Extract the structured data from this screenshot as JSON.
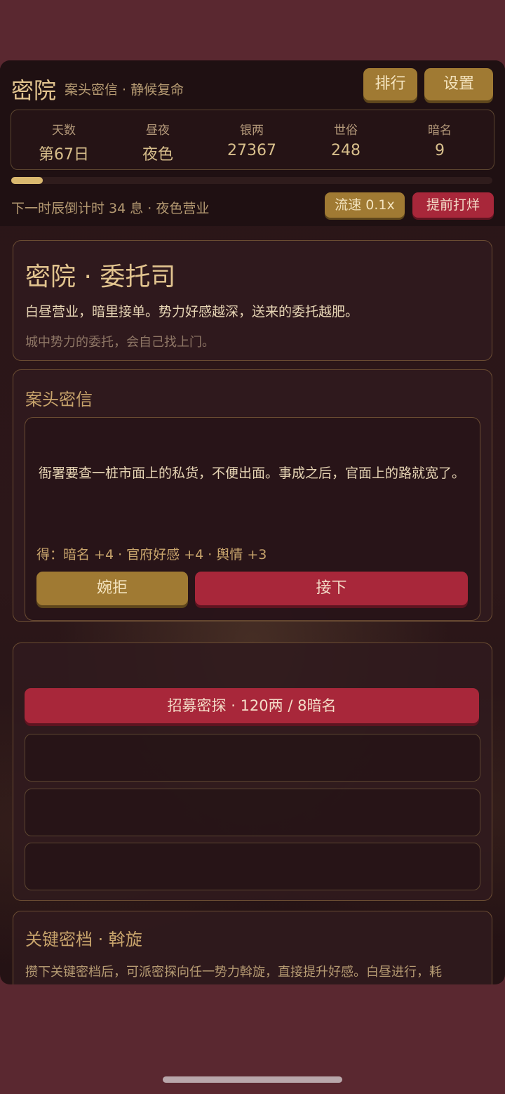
{
  "header": {
    "title": "密院",
    "subtitle": "案头密信 · 静候复命",
    "rank_label": "排行",
    "settings_label": "设置"
  },
  "stats": [
    {
      "label": "天数",
      "value": "第67日"
    },
    {
      "label": "昼夜",
      "value": "夜色"
    },
    {
      "label": "银两",
      "value": "27367"
    },
    {
      "label": "世俗",
      "value": "248"
    },
    {
      "label": "暗名",
      "value": "9"
    }
  ],
  "progress": {
    "fraction": 0.065
  },
  "timer": {
    "countdown_text": "下一时辰倒计时 34 息 · 夜色营业",
    "speed_label": "流速 0.1x",
    "close_early_label": "提前打烊"
  },
  "intro": {
    "title": "密院 · 委托司",
    "desc": "白昼营业，暗里接单。势力好感越深，送来的委托越肥。",
    "hint": "城中势力的委托，会自己找上门。"
  },
  "letters": {
    "title": "案头密信",
    "letter": {
      "body": "衙署要查一桩市面上的私货，不便出面。事成之后，官面上的路就宽了。",
      "reward": "得：暗名 +4 · 官府好感 +4 · 舆情 +3",
      "decline_label": "婉拒",
      "accept_label": "接下"
    }
  },
  "agents": {
    "recruit_label": "招募密探 · 120两 / 8暗名",
    "slots": [
      "",
      "",
      ""
    ]
  },
  "archive": {
    "title": "关键密档 · 斡旋",
    "desc": "攒下关键密档后，可派密探向任一势力斡旋，直接提升好感。白昼进行，耗"
  },
  "colors": {
    "accent_gold": "#a07a33",
    "accent_red": "#a8273a",
    "text_gold": "#d8bf8c",
    "outer_bg": "#5a2830"
  }
}
